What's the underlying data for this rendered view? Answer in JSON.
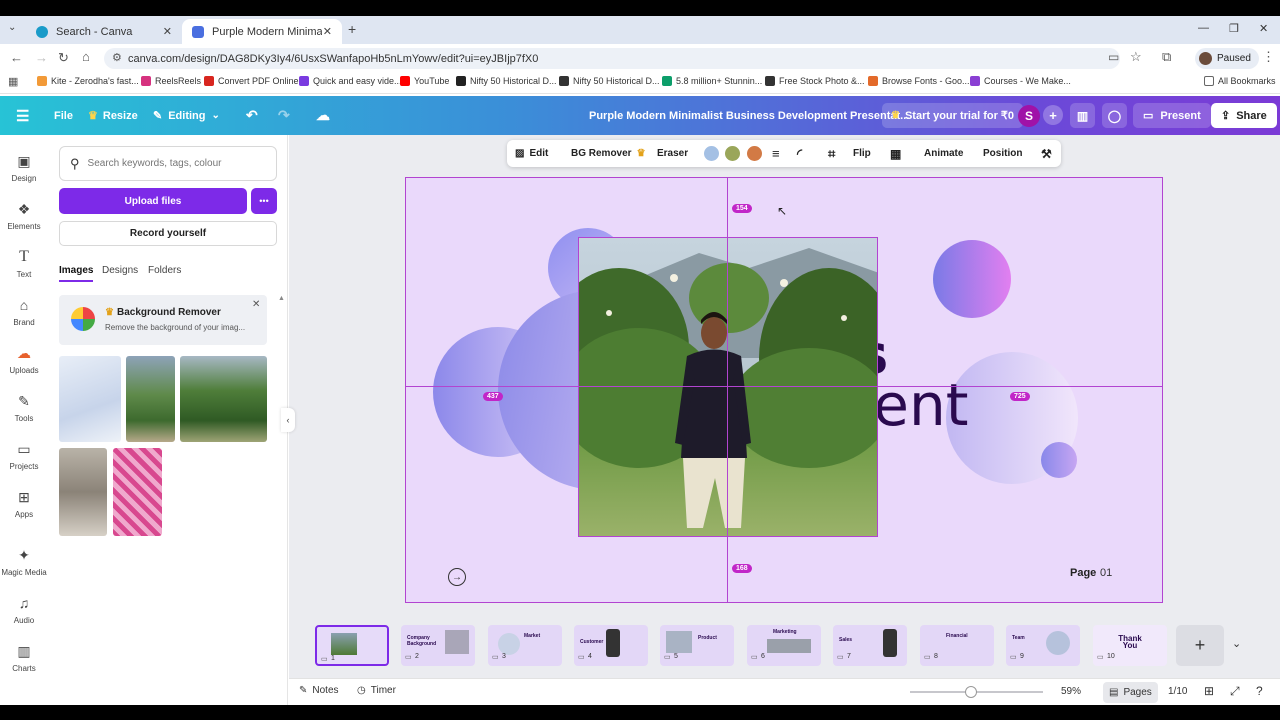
{
  "browser": {
    "tabs": [
      {
        "title": "Search - Canva",
        "active": false
      },
      {
        "title": "Purple Modern Minimalist Busi",
        "active": true
      }
    ],
    "new_tab": "+",
    "url": "canva.com/design/DAG8DKy3Iy4/6UsxSWanfapoHb5nLmYowv/edit?ui=eyJBIjp7fX0",
    "profile_status": "Paused",
    "bookmarks": [
      "Kite - Zerodha's fast...",
      "ReelsReels",
      "Convert PDF Online",
      "Quick and easy vide...",
      "YouTube",
      "Nifty 50 Historical D...",
      "Nifty 50 Historical D...",
      "5.8 million+ Stunnin...",
      "Free Stock Photo &...",
      "Browse Fonts - Goo...",
      "Courses - We Make..."
    ],
    "all_bookmarks": "All Bookmarks"
  },
  "header": {
    "file": "File",
    "resize": "Resize",
    "editing": "Editing",
    "title": "Purple Modern Minimalist Business Development Presentat...",
    "trial": "Start your trial for ₹0",
    "avatar_letter": "S",
    "present": "Present",
    "share": "Share"
  },
  "rail": [
    "Design",
    "Elements",
    "Text",
    "Brand",
    "Uploads",
    "Tools",
    "Projects",
    "Apps",
    "Magic Media",
    "Audio",
    "Charts"
  ],
  "panel": {
    "search_placeholder": "Search keywords, tags, colour",
    "upload": "Upload files",
    "more": "•••",
    "record": "Record yourself",
    "tabs": [
      "Images",
      "Designs",
      "Folders"
    ],
    "bg_remover_title": "Background Remover",
    "bg_remover_desc": "Remove the background of your imag..."
  },
  "context_toolbar": {
    "edit": "Edit",
    "bg_remover": "BG Remover",
    "eraser": "Eraser",
    "flip": "Flip",
    "animate": "Animate",
    "position": "Position",
    "swatches": [
      "#a4c0e4",
      "#9aa65a",
      "#d27a45"
    ]
  },
  "slide": {
    "heading_partial": "ss",
    "heading": "Development",
    "page_label": "Page",
    "page_number": "01",
    "guides": {
      "top": "154",
      "left": "437",
      "right": "725",
      "bottom": "168"
    }
  },
  "thumbnails": [
    {
      "n": "1",
      "label": ""
    },
    {
      "n": "2",
      "label": "Company Background"
    },
    {
      "n": "3",
      "label": "Market"
    },
    {
      "n": "4",
      "label": "Customer"
    },
    {
      "n": "5",
      "label": "Product"
    },
    {
      "n": "6",
      "label": "Marketing"
    },
    {
      "n": "7",
      "label": "Sales"
    },
    {
      "n": "8",
      "label": "Financial"
    },
    {
      "n": "9",
      "label": "Team"
    },
    {
      "n": "10",
      "label": "Thank You"
    }
  ],
  "bottom": {
    "notes": "Notes",
    "timer": "Timer",
    "zoom": "59%",
    "pages": "Pages",
    "page_count": "1/10"
  },
  "colors": {
    "accent": "#7d2ae8",
    "slide_bg": "#ead9fb",
    "text_dark": "#2a0a4f"
  }
}
